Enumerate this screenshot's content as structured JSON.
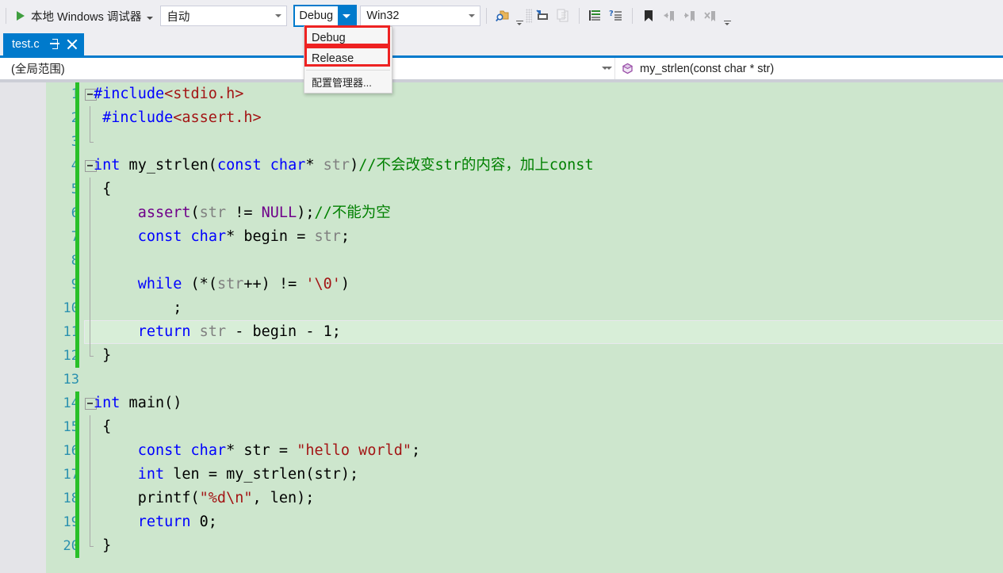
{
  "toolbar": {
    "start_debug_label": "本地 Windows 调试器",
    "start_debug_icon": "play-triangle-icon",
    "platform_target": {
      "value": "自动",
      "icon": "chevron-down-icon"
    },
    "configuration": {
      "value": "Debug",
      "icon": "chevron-down-icon"
    },
    "platform": {
      "value": "Win32",
      "icon": "chevron-down-icon"
    },
    "icons": [
      "find-in-files-icon",
      "overflow-chevron-icon",
      "toolbar-grip-icon",
      "quick-replace-icon",
      "comment-block-icon",
      "increase-indent-icon",
      "comment-selection-icon",
      "uncomment-selection-icon",
      "toggle-bookmark-icon",
      "previous-bookmark-icon",
      "next-bookmark-icon",
      "clear-bookmarks-icon",
      "overflow-chevron-icon"
    ]
  },
  "config_dropdown": {
    "open": true,
    "highlight_color": "#ee2222",
    "items": [
      {
        "label": "Debug",
        "highlighted": true
      },
      {
        "label": "Release",
        "highlighted": true
      },
      {
        "label": "配置管理器...",
        "highlighted": false
      }
    ]
  },
  "tabs": [
    {
      "title": "test.c",
      "active": true,
      "pin_icon": "pin-icon",
      "close_icon": "close-icon",
      "active_color": "#007acc"
    }
  ],
  "navbar": {
    "scope": "(全局范围)",
    "scope_chevron_icon": "chevron-down-icon",
    "member_chevron_icon": "chevron-down-icon",
    "member_icon": "method-icon",
    "member": "my_strlen(const char * str)"
  },
  "editor": {
    "background_color": "#cde6cd",
    "current_line": 11,
    "changebar_color": "#28c028",
    "lineno_color": "#2b91af",
    "lines": [
      {
        "n": "1",
        "outline": "box",
        "changed": true,
        "tokens": [
          {
            "t": "#include",
            "c": "pre"
          },
          {
            "t": "<stdio.h>",
            "c": "str"
          }
        ]
      },
      {
        "n": "2",
        "outline": "bar",
        "changed": true,
        "tokens": [
          {
            "t": " ",
            "c": "pln"
          },
          {
            "t": "#include",
            "c": "pre"
          },
          {
            "t": "<assert.h>",
            "c": "str"
          }
        ]
      },
      {
        "n": "3",
        "outline": "end",
        "changed": true,
        "tokens": []
      },
      {
        "n": "4",
        "outline": "box",
        "changed": true,
        "tokens": [
          {
            "t": "int",
            "c": "kw"
          },
          {
            "t": " my_strlen(",
            "c": "pln"
          },
          {
            "t": "const",
            "c": "kw"
          },
          {
            "t": " ",
            "c": "pln"
          },
          {
            "t": "char",
            "c": "kw"
          },
          {
            "t": "* ",
            "c": "pln"
          },
          {
            "t": "str",
            "c": "par"
          },
          {
            "t": ")",
            "c": "pln"
          },
          {
            "t": "//不会改变str的内容，加上const",
            "c": "cmt"
          }
        ]
      },
      {
        "n": "5",
        "outline": "bar",
        "changed": true,
        "tokens": [
          {
            "t": " {",
            "c": "pln"
          }
        ]
      },
      {
        "n": "6",
        "outline": "bar",
        "changed": true,
        "tokens": [
          {
            "t": "     ",
            "c": "pln"
          },
          {
            "t": "assert",
            "c": "mac"
          },
          {
            "t": "(",
            "c": "pln"
          },
          {
            "t": "str",
            "c": "par"
          },
          {
            "t": " != ",
            "c": "pln"
          },
          {
            "t": "NULL",
            "c": "mac"
          },
          {
            "t": ");",
            "c": "pln"
          },
          {
            "t": "//不能为空",
            "c": "cmt"
          }
        ]
      },
      {
        "n": "7",
        "outline": "bar",
        "changed": true,
        "tokens": [
          {
            "t": "     ",
            "c": "pln"
          },
          {
            "t": "const",
            "c": "kw"
          },
          {
            "t": " ",
            "c": "pln"
          },
          {
            "t": "char",
            "c": "kw"
          },
          {
            "t": "* begin = ",
            "c": "pln"
          },
          {
            "t": "str",
            "c": "par"
          },
          {
            "t": ";",
            "c": "pln"
          }
        ]
      },
      {
        "n": "8",
        "outline": "bar",
        "changed": true,
        "tokens": []
      },
      {
        "n": "9",
        "outline": "bar",
        "changed": true,
        "tokens": [
          {
            "t": "     ",
            "c": "pln"
          },
          {
            "t": "while",
            "c": "kw"
          },
          {
            "t": " (*(",
            "c": "pln"
          },
          {
            "t": "str",
            "c": "par"
          },
          {
            "t": "++) != ",
            "c": "pln"
          },
          {
            "t": "'\\0'",
            "c": "str"
          },
          {
            "t": ")",
            "c": "pln"
          }
        ]
      },
      {
        "n": "10",
        "outline": "bar",
        "changed": true,
        "tokens": [
          {
            "t": "         ;",
            "c": "pln"
          }
        ]
      },
      {
        "n": "11",
        "outline": "bar",
        "changed": true,
        "current": true,
        "tokens": [
          {
            "t": "     ",
            "c": "pln"
          },
          {
            "t": "return",
            "c": "kw"
          },
          {
            "t": " ",
            "c": "pln"
          },
          {
            "t": "str",
            "c": "par"
          },
          {
            "t": " - begin - 1;",
            "c": "pln"
          }
        ]
      },
      {
        "n": "12",
        "outline": "end",
        "changed": true,
        "tokens": [
          {
            "t": " }",
            "c": "pln"
          }
        ]
      },
      {
        "n": "13",
        "outline": "",
        "changed": false,
        "tokens": []
      },
      {
        "n": "14",
        "outline": "box",
        "changed": true,
        "tokens": [
          {
            "t": "int",
            "c": "kw"
          },
          {
            "t": " main()",
            "c": "pln"
          }
        ]
      },
      {
        "n": "15",
        "outline": "bar",
        "changed": true,
        "tokens": [
          {
            "t": " {",
            "c": "pln"
          }
        ]
      },
      {
        "n": "16",
        "outline": "bar",
        "changed": true,
        "tokens": [
          {
            "t": "     ",
            "c": "pln"
          },
          {
            "t": "const",
            "c": "kw"
          },
          {
            "t": " ",
            "c": "pln"
          },
          {
            "t": "char",
            "c": "kw"
          },
          {
            "t": "* str = ",
            "c": "pln"
          },
          {
            "t": "\"hello world\"",
            "c": "str"
          },
          {
            "t": ";",
            "c": "pln"
          }
        ]
      },
      {
        "n": "17",
        "outline": "bar",
        "changed": true,
        "tokens": [
          {
            "t": "     ",
            "c": "pln"
          },
          {
            "t": "int",
            "c": "kw"
          },
          {
            "t": " len = my_strlen(str);",
            "c": "pln"
          }
        ]
      },
      {
        "n": "18",
        "outline": "bar",
        "changed": true,
        "tokens": [
          {
            "t": "     printf(",
            "c": "pln"
          },
          {
            "t": "\"%d\\n\"",
            "c": "str"
          },
          {
            "t": ", len);",
            "c": "pln"
          }
        ]
      },
      {
        "n": "19",
        "outline": "bar",
        "changed": true,
        "tokens": [
          {
            "t": "     ",
            "c": "pln"
          },
          {
            "t": "return",
            "c": "kw"
          },
          {
            "t": " 0;",
            "c": "pln"
          }
        ]
      },
      {
        "n": "20",
        "outline": "end",
        "changed": true,
        "tokens": [
          {
            "t": " }",
            "c": "pln"
          }
        ]
      }
    ]
  }
}
